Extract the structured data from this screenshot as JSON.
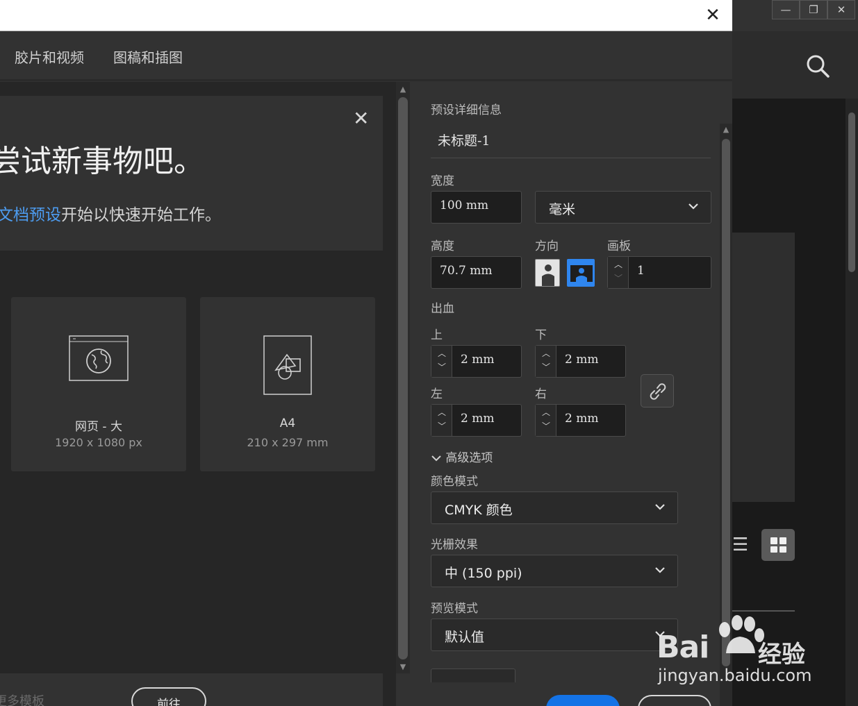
{
  "background_window": {
    "controls": {
      "minimize": "—",
      "restore": "❐",
      "close": "✕"
    }
  },
  "dialog": {
    "close_glyph": "✕",
    "tabs": [
      "胶片和视频",
      "图稿和插图"
    ]
  },
  "promo": {
    "close_glyph": "✕",
    "title": "尝试新事物吧。",
    "subtitle_link": "文档预设",
    "subtitle_rest": "开始以快速开始工作。"
  },
  "presets": [
    {
      "name": "网页 - 大",
      "size": "1920 x 1080 px",
      "icon": "web-globe-icon"
    },
    {
      "name": "A4",
      "size": "210 x 297 mm",
      "icon": "document-shapes-icon"
    }
  ],
  "bottom": {
    "more_templates": "更多模板",
    "goto_label": "前往"
  },
  "details": {
    "section_title": "预设详细信息",
    "doc_name": "未标题-1",
    "width_label": "宽度",
    "width_value": "100 mm",
    "unit_value": "毫米",
    "height_label": "高度",
    "height_value": "70.7 mm",
    "orientation_label": "方向",
    "artboards_label": "画板",
    "artboards_value": "1",
    "bleed_label": "出血",
    "bleed_top_label": "上",
    "bleed_top_value": "2 mm",
    "bleed_bottom_label": "下",
    "bleed_bottom_value": "2 mm",
    "bleed_left_label": "左",
    "bleed_left_value": "2 mm",
    "bleed_right_label": "右",
    "bleed_right_value": "2 mm",
    "advanced_label": "高级选项",
    "color_mode_label": "颜色模式",
    "color_mode_value": "CMYK 颜色",
    "raster_label": "光栅效果",
    "raster_value": "中 (150 ppi)",
    "preview_label": "预览模式",
    "preview_value": "默认值"
  },
  "watermark": {
    "brand": "Bai",
    "brand_cn": "经验",
    "url": "jingyan.baidu.com"
  },
  "colors": {
    "accent": "#1473e6",
    "link": "#4d9cf0",
    "dialog_bg": "#323232",
    "content_bg": "#262626"
  }
}
